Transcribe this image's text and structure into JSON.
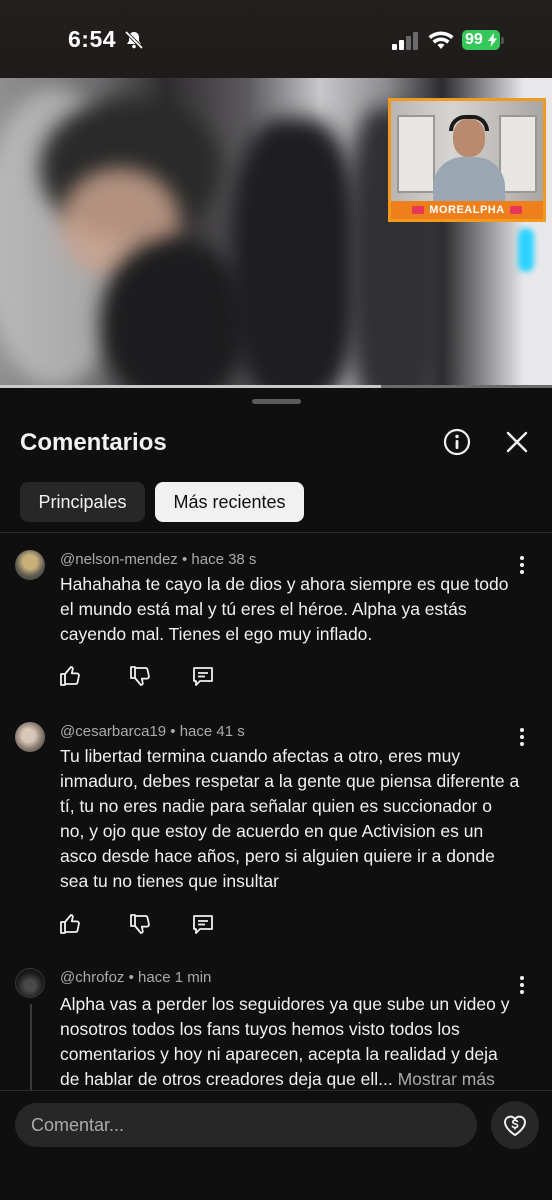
{
  "status_bar": {
    "time": "6:54",
    "battery": "99"
  },
  "video": {
    "overlay_channel": "MOREALPHA",
    "progress": 0.69
  },
  "comments_panel": {
    "title": "Comentarios",
    "chips": [
      "Principales",
      "Más recientes"
    ],
    "selected_chip": "Más recientes"
  },
  "comments": [
    {
      "author": "@nelson-mendez",
      "time": "hace 38 s",
      "text": "Hahahaha te cayo la de dios y ahora siempre es que todo el mundo está mal y tú eres el héroe. Alpha ya estás cayendo mal. Tienes el ego muy inflado."
    },
    {
      "author": "@cesarbarca19",
      "time": "hace 41 s",
      "text": "Tu libertad termina cuando afectas a otro, eres muy inmaduro, debes respetar a la gente que piensa diferente a tí, tu no eres nadie para señalar quien es succionador o no, y ojo que estoy de acuerdo en que Activision es un asco desde hace años, pero si alguien quiere ir a donde sea tu no tienes que insultar"
    },
    {
      "author": "@chrofoz",
      "time": "hace 1 min",
      "text": "Alpha vas a perder los seguidores ya que sube un video y nosotros todos los fans tuyos hemos visto todos los comentarios y hoy ni aparecen, acepta la realidad y deja de hablar de otros creadores deja que ell...",
      "show_more": "Mostrar más"
    }
  ],
  "composer": {
    "placeholder": "Comentar..."
  }
}
